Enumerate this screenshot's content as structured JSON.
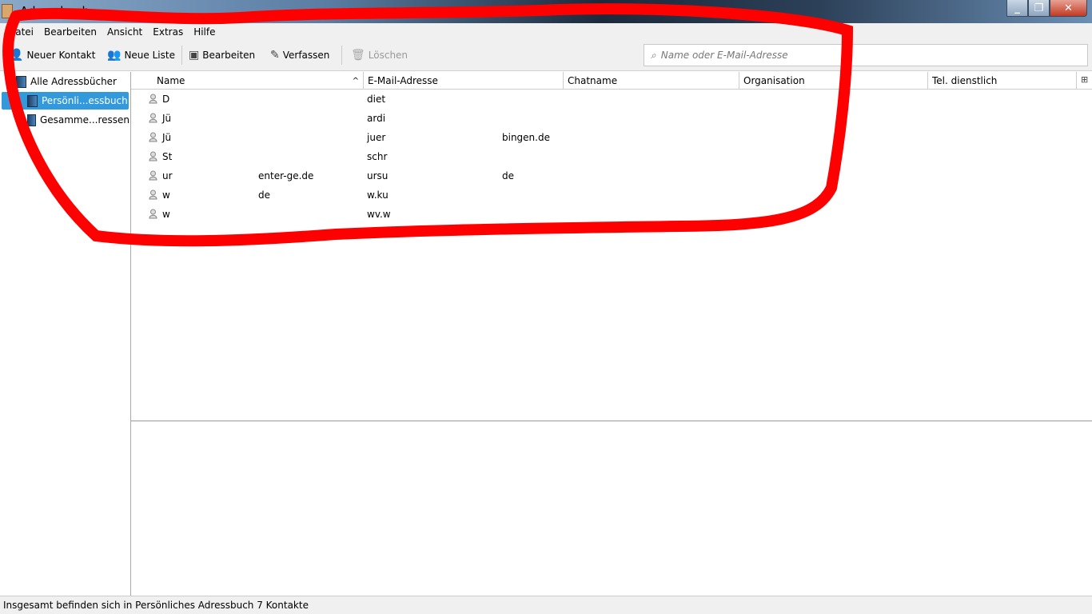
{
  "window": {
    "title": "Adressbuch"
  },
  "menu": [
    "Datei",
    "Bearbeiten",
    "Ansicht",
    "Extras",
    "Hilfe"
  ],
  "toolbar": {
    "new_contact": "Neuer Kontakt",
    "new_list": "Neue Liste",
    "edit": "Bearbeiten",
    "compose": "Verfassen",
    "delete": "Löschen"
  },
  "search": {
    "placeholder": "Name oder E-Mail-Adresse"
  },
  "sidebar": {
    "items": [
      "Alle Adressbücher",
      "Persönli...essbuch",
      "Gesamme...ressen"
    ]
  },
  "columns": [
    "Name",
    "E-Mail-Adresse",
    "Chatname",
    "Organisation",
    "Tel. dienstlich"
  ],
  "contacts": [
    {
      "name": "D",
      "name_tail": "",
      "email": "diet",
      "email_tail": ""
    },
    {
      "name": "Jü",
      "name_tail": "",
      "email": "ardi",
      "email_tail": ""
    },
    {
      "name": "Jü",
      "name_tail": "",
      "email": "juer",
      "email_tail": "bingen.de"
    },
    {
      "name": "St",
      "name_tail": "",
      "email": "schr",
      "email_tail": ""
    },
    {
      "name": "ur",
      "name_tail": "enter-ge.de",
      "email": "ursu",
      "email_tail": "de"
    },
    {
      "name": "w",
      "name_tail": "de",
      "email": "w.ku",
      "email_tail": ""
    },
    {
      "name": "w",
      "name_tail": "",
      "email": "wv.w",
      "email_tail": ""
    }
  ],
  "status": "Insgesamt befinden sich in Persönliches Adressbuch 7 Kontakte",
  "colors": {
    "selection": "#3399dd",
    "annotation": "#ff0000"
  }
}
